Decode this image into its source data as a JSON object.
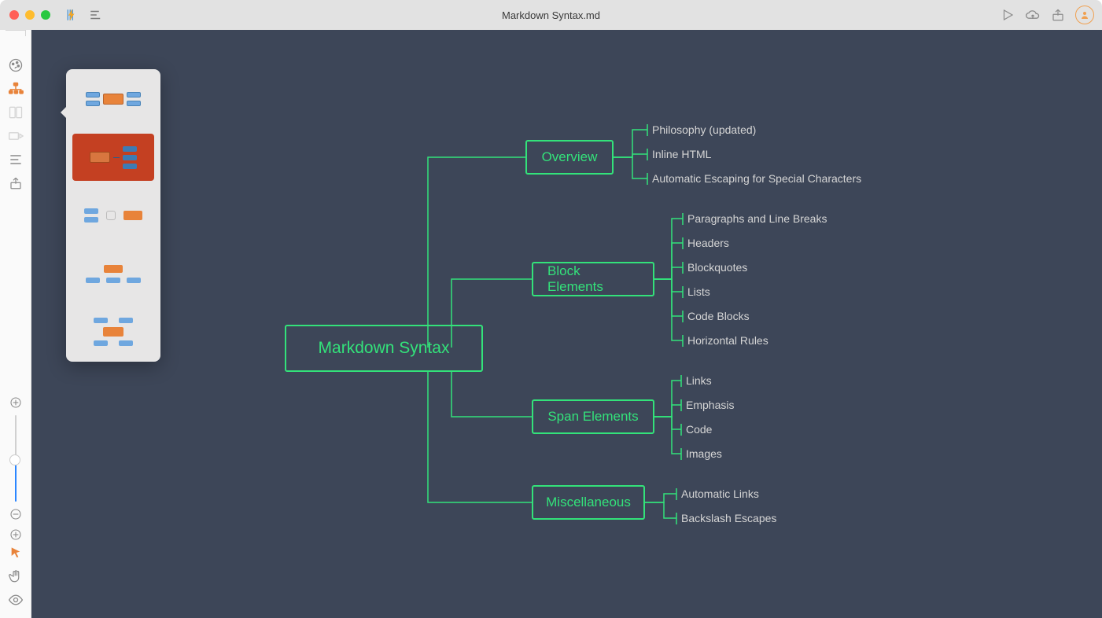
{
  "titlebar": {
    "title": "Markdown Syntax.md"
  },
  "sidebar": {
    "items": [
      {
        "name": "theme-icon"
      },
      {
        "name": "layout-icon"
      },
      {
        "name": "columns-icon"
      },
      {
        "name": "slides-icon"
      },
      {
        "name": "outline-list-icon"
      },
      {
        "name": "export-icon"
      }
    ],
    "active_index": 1
  },
  "layout_popover": {
    "options": [
      {
        "name": "layout-radial"
      },
      {
        "name": "layout-right-tree"
      },
      {
        "name": "layout-left-right"
      },
      {
        "name": "layout-org-chart"
      },
      {
        "name": "layout-tree-down"
      }
    ],
    "selected_index": 1
  },
  "mindmap": {
    "root": "Markdown Syntax",
    "branches": [
      {
        "label": "Overview",
        "children": [
          "Philosophy (updated)",
          "Inline HTML",
          "Automatic Escaping for Special Characters"
        ]
      },
      {
        "label": "Block Elements",
        "children": [
          "Paragraphs and Line Breaks",
          "Headers",
          "Blockquotes",
          "Lists",
          "Code Blocks",
          "Horizontal Rules"
        ]
      },
      {
        "label": "Span Elements",
        "children": [
          "Links",
          "Emphasis",
          "Code",
          "Images"
        ]
      },
      {
        "label": "Miscellaneous",
        "children": [
          "Automatic Links",
          "Backslash Escapes"
        ]
      }
    ]
  },
  "toolbar_right": {
    "play": "play-icon",
    "cloud": "cloud-upload-icon",
    "share": "share-icon",
    "account": "account-avatar"
  },
  "tools_bottom": {
    "pointer": "pointer-tool",
    "hand": "hand-tool",
    "eye": "visibility-tool"
  },
  "zoom": {
    "plus": "zoom-in",
    "minus": "zoom-out",
    "fit": "zoom-fit"
  }
}
